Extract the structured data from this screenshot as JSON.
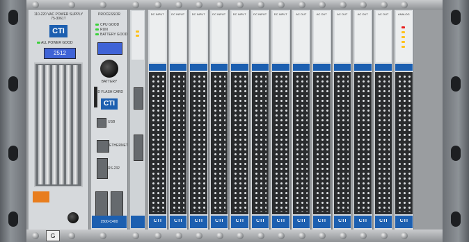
{
  "power_supply": {
    "title": "110-220 VAC POWER SUPPLY",
    "model": "75-3061T",
    "status": "ALL POWER GOOD",
    "rack_number": "2512",
    "brand": "CTI"
  },
  "processor": {
    "title": "PROCESSOR",
    "leds": [
      "CPU GOOD",
      "RUN",
      "BATTERY GOOD"
    ],
    "battery_label": "BATTERY",
    "sd_label": "SD FLASH CARD",
    "brand": "CTI",
    "usb_label": "USB",
    "eth_label": "ETHERNET",
    "rs232_label": "RS-232",
    "model": "2500-C400"
  },
  "io_modules": [
    {
      "title": "DC INPUT",
      "brand": "CTI"
    },
    {
      "title": "DC INPUT",
      "brand": "CTI"
    },
    {
      "title": "DC INPUT",
      "brand": "CTI"
    },
    {
      "title": "DC INPUT",
      "brand": "CTI"
    },
    {
      "title": "DC INPUT",
      "brand": "CTI"
    },
    {
      "title": "DC INPUT",
      "brand": "CTI"
    },
    {
      "title": "DC INPUT",
      "brand": "CTI"
    },
    {
      "title": "AC OUT",
      "brand": "CTI"
    },
    {
      "title": "AC OUT",
      "brand": "CTI"
    },
    {
      "title": "AC OUT",
      "brand": "CTI"
    },
    {
      "title": "AC OUT",
      "brand": "CTI"
    },
    {
      "title": "AC OUT",
      "brand": "CTI"
    },
    {
      "title": "ANALOG",
      "brand": "CTI"
    }
  ],
  "bottom_badge": "G"
}
